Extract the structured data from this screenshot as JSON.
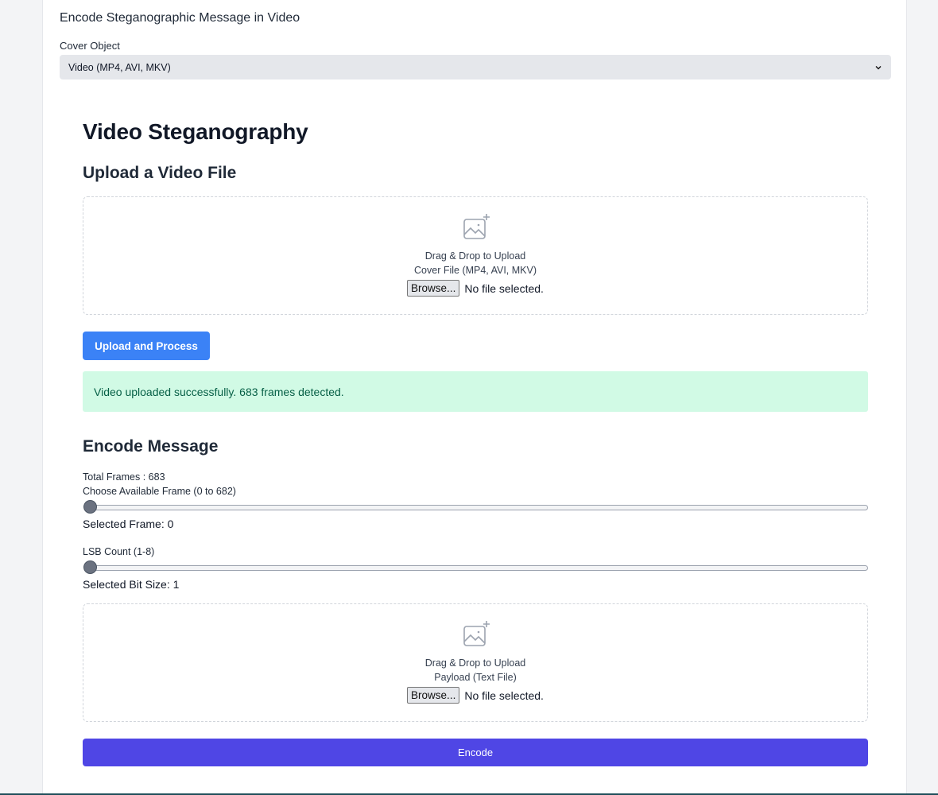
{
  "header": {
    "title": "Encode Steganographic Message in Video",
    "cover_label": "Cover Object",
    "cover_selected": "Video (MP4, AVI, MKV)"
  },
  "main": {
    "title": "Video Steganography",
    "upload_heading": "Upload a Video File",
    "cover_dropzone": {
      "icon": "image-add-icon",
      "line1": "Drag & Drop to Upload",
      "line2": "Cover File (MP4, AVI, MKV)",
      "browse_label": "Browse...",
      "file_status": "No file selected."
    },
    "upload_button": "Upload and Process",
    "success_message": "Video uploaded successfully. 683 frames detected.",
    "encode_heading": "Encode Message",
    "total_frames_label": "Total Frames : 683",
    "frame_slider_label": "Choose Available Frame (0 to 682)",
    "frame_slider": {
      "min": 0,
      "max": 682,
      "value": 0
    },
    "selected_frame_label": "Selected Frame: 0",
    "lsb_label": "LSB Count (1-8)",
    "lsb_slider": {
      "min": 1,
      "max": 8,
      "value": 1
    },
    "selected_bit_label": "Selected Bit Size: 1",
    "payload_dropzone": {
      "icon": "image-add-icon",
      "line1": "Drag & Drop to Upload",
      "line2": "Payload (Text File)",
      "browse_label": "Browse...",
      "file_status": "No file selected."
    },
    "encode_button": "Encode"
  },
  "colors": {
    "primary": "#3b82f6",
    "encode": "#4f46e5",
    "success_bg": "#d1fae5",
    "success_text": "#065f46"
  }
}
